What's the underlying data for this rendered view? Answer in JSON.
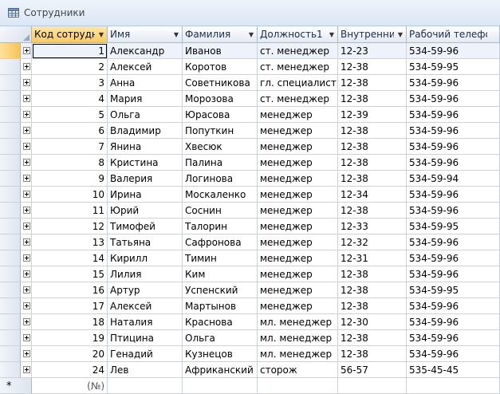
{
  "window": {
    "title": "Сотрудники"
  },
  "columns": [
    {
      "label": "Код сотрудн",
      "sorted": true
    },
    {
      "label": "Имя"
    },
    {
      "label": "Фамилия"
    },
    {
      "label": "Должность1"
    },
    {
      "label": "Внутренни"
    },
    {
      "label": "Рабочий телефон"
    }
  ],
  "rows": [
    [
      "1",
      "Александр",
      "Иванов",
      "ст. менеджер",
      "12-23",
      "534-59-96"
    ],
    [
      "2",
      "Алексей",
      "Коротов",
      "ст. менеджер",
      "12-38",
      "534-59-95"
    ],
    [
      "3",
      "Анна",
      "Советникова",
      "гл. специалист",
      "12-38",
      "534-59-96"
    ],
    [
      "4",
      "Мария",
      "Морозова",
      "ст. менеджер",
      "12-38",
      "534-59-96"
    ],
    [
      "5",
      "Ольга",
      "Юрасова",
      "менеджер",
      "12-39",
      "534-59-96"
    ],
    [
      "6",
      "Владимир",
      "Попуткин",
      "менеджер",
      "12-38",
      "534-59-96"
    ],
    [
      "7",
      "Янина",
      "Хвесюк",
      "менеджер",
      "12-38",
      "534-59-96"
    ],
    [
      "8",
      "Кристина",
      "Палина",
      "менеджер",
      "12-38",
      "534-59-96"
    ],
    [
      "9",
      "Валерия",
      "Логинова",
      "менеджер",
      "12-38",
      "534-59-94"
    ],
    [
      "10",
      "Ирина",
      "Москаленко",
      "менеджер",
      "12-34",
      "534-59-96"
    ],
    [
      "11",
      "Юрий",
      "Соснин",
      "менеджер",
      "12-38",
      "534-59-96"
    ],
    [
      "12",
      "Тимофей",
      "Талорин",
      "менеджер",
      "12-33",
      "534-59-95"
    ],
    [
      "13",
      "Татьяна",
      "Сафронова",
      "менеджер",
      "12-32",
      "534-59-96"
    ],
    [
      "14",
      "Кирилл",
      "Тимин",
      "менеджер",
      "12-31",
      "534-59-96"
    ],
    [
      "15",
      "Лилия",
      "Ким",
      "менеджер",
      "12-38",
      "534-59-96"
    ],
    [
      "16",
      "Артур",
      "Успенский",
      "менеджер",
      "12-38",
      "534-59-95"
    ],
    [
      "17",
      "Алексей",
      "Мартынов",
      "менеджер",
      "12-38",
      "534-59-96"
    ],
    [
      "18",
      "Наталия",
      "Краснова",
      "мл. менеджер",
      "12-30",
      "534-59-96"
    ],
    [
      "19",
      "Птицина",
      "Ольга",
      "мл. менеджер",
      "12-38",
      "534-59-96"
    ],
    [
      "20",
      "Генадий",
      "Кузнецов",
      "мл. менеджер",
      "12-38",
      "534-59-96"
    ],
    [
      "24",
      "Лев",
      "Африканский",
      "сторож",
      "56-57",
      "535-45-45"
    ]
  ],
  "new_row": {
    "id_placeholder": "(№)",
    "marker": "*"
  },
  "icons": {
    "window": "table-icon",
    "expand": "plus-box-icon",
    "sort": "dropdown-arrow-icon"
  },
  "colors": {
    "current_row": "#f6c455",
    "grid_line": "#c9d3df"
  }
}
